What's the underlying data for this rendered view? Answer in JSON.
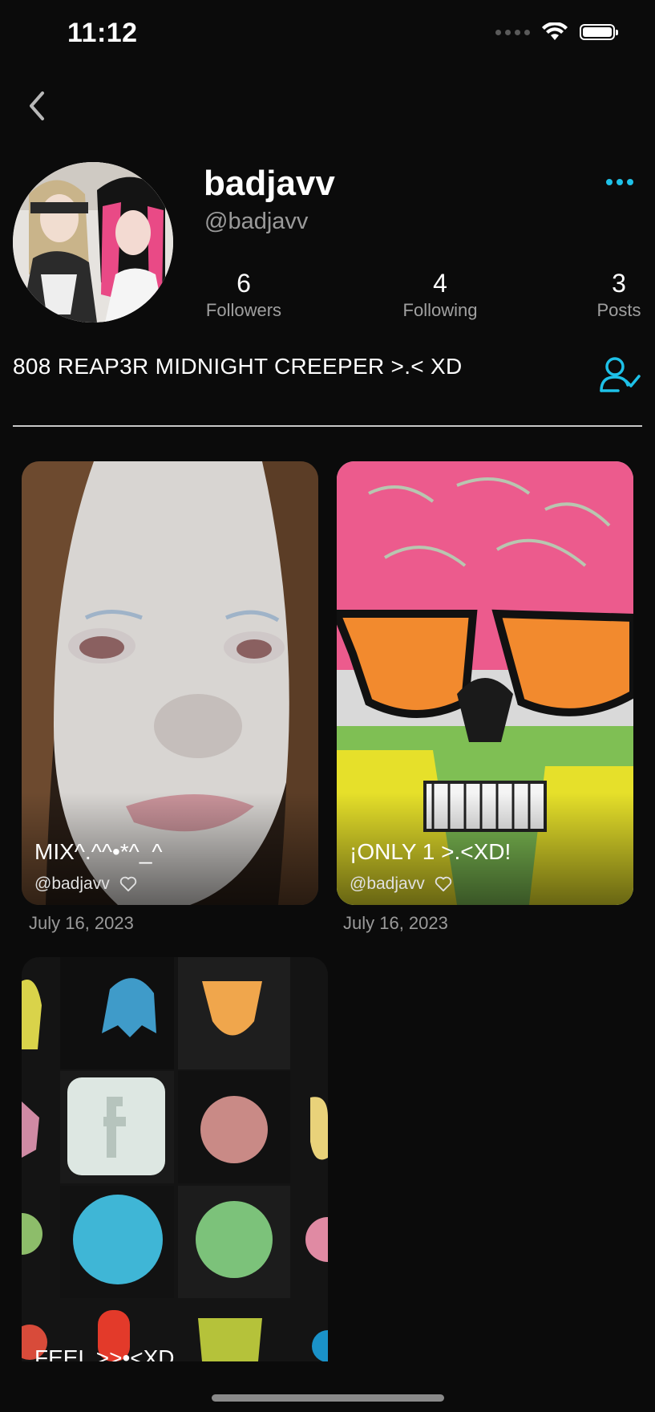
{
  "status_bar": {
    "time": "11:12"
  },
  "profile": {
    "name": "badjavv",
    "handle": "@badjavv",
    "bio": "808 REAP3R MIDNIGHT CREEPER >.< XD",
    "stats": {
      "followers": {
        "value": "6",
        "label": "Followers"
      },
      "following": {
        "value": "4",
        "label": "Following"
      },
      "posts": {
        "value": "3",
        "label": "Posts"
      }
    }
  },
  "posts": [
    {
      "title": "MIX^.^^•*^_^",
      "author": "@badjavv",
      "date": "July 16, 2023"
    },
    {
      "title": "¡ONLY 1 >.<XD!",
      "author": "@badjavv",
      "date": "July 16, 2023"
    },
    {
      "title": "FEEL >>•<XD"
    }
  ],
  "colors": {
    "accent": "#1ec1e8",
    "background": "#0b0b0b"
  },
  "icons": {
    "back": "chevron-left-icon",
    "more": "more-dots-icon",
    "follow": "user-check-icon",
    "like": "heart-outline-icon"
  }
}
